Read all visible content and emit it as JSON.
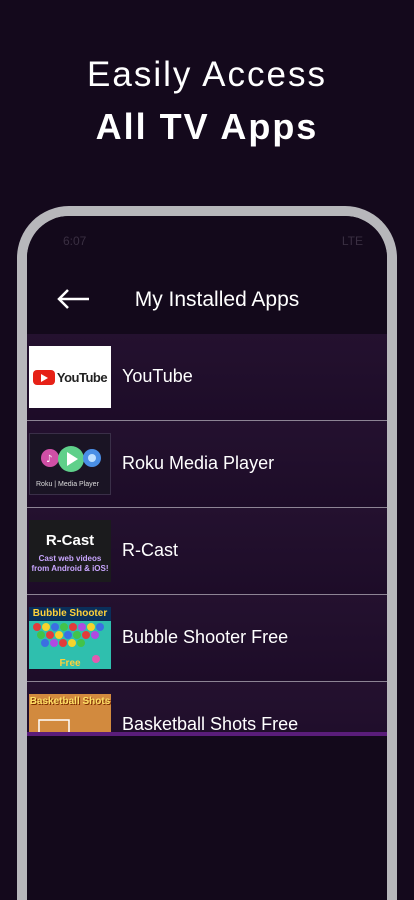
{
  "promo": {
    "line1": "Easily Access",
    "line2": "All TV Apps"
  },
  "status_bar": {
    "time": "6:07",
    "indicators": "LTE"
  },
  "navbar": {
    "back_icon": "arrow-left-icon",
    "title": "My Installed Apps"
  },
  "apps": [
    {
      "name": "YouTube",
      "thumb_text": "YouTube"
    },
    {
      "name": "Roku Media Player",
      "thumb_text": "Roku | Media Player"
    },
    {
      "name": "R-Cast",
      "thumb_title": "R-Cast",
      "thumb_text": "Cast web videos from Android & iOS!"
    },
    {
      "name": "Bubble Shooter Free",
      "thumb_title": "Bubble Shooter",
      "thumb_text": "Free"
    },
    {
      "name": "Basketball Shots Free",
      "thumb_title": "Basketball Shots"
    }
  ],
  "colors": {
    "background": "#14091c",
    "accent": "#5a1d7a",
    "frame": "#b7b7bb"
  }
}
